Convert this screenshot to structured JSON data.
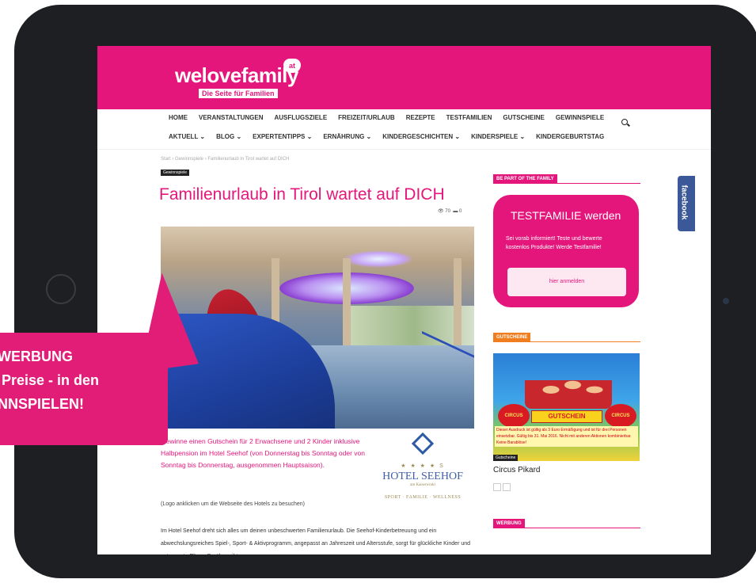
{
  "site": {
    "logo": "welovefamily",
    "logo_badge": "at",
    "tagline": "Die Seite für Familien"
  },
  "nav": {
    "row1": [
      "HOME",
      "VERANSTALTUNGEN",
      "AUSFLUGSZIELE",
      "FREIZEIT/URLAUB",
      "REZEPTE",
      "TESTFAMILIEN",
      "GUTSCHEINE",
      "GEWINNSPIELE"
    ],
    "row2": [
      "AKTUELL ⌄",
      "BLOG ⌄",
      "EXPERTENTIPPS ⌄",
      "ERNÄHRUNG ⌄",
      "KINDERGESCHICHTEN ⌄",
      "KINDERSPIELE ⌄",
      "KINDERGEBURTSTAG"
    ]
  },
  "article": {
    "breadcrumb": "Start › Gewinnspiele › Familienurlaub in Tirol wartet auf DICH",
    "category": "Gewinnspiele",
    "title": "Familienurlaub in Tirol wartet auf DICH",
    "views": "👁 70",
    "comments": "▬ 0",
    "intro": "Gewinne einen Gutschein für 2 Erwachsene und 2 Kinder inklusive Halbpension im Hotel Seehof (von Donnerstag bis Sonntag oder von Sonntag bis Donnerstag, ausgenommen Hauptsaison).",
    "logo_note": "(Logo anklicken um die Webseite des Hotels zu besuchen)",
    "body": "Im Hotel Seehof dreht sich alles um deinen unbeschwerten Familienurlaub. Die Seehof-Kinderbetreuung und ein abwechslungsreiches Spiel-, Sport- & Aktivprogramm, angepasst an Jahreszeit und Altersstufe, sorgt für glückliche Kinder und entspannte Eltern. Darüber gibt es"
  },
  "hotel": {
    "stars": "★ ★ ★ ★ S",
    "name": "HOTEL SEEHOF",
    "sub": "am Kaiserwinkl",
    "tagline": "SPORT · FAMILIE · WELLNESS"
  },
  "sidebar": {
    "family_header": "BE PART OF THE FAMILY",
    "tf_title": "TESTFAMILIE werden",
    "tf_text": "Sei vorab informiert! Teste und bewerte kostenlos Produkte! Werde Testfamilie!",
    "tf_button": "hier anmelden",
    "gutschein_header": "GUTSCHEINE",
    "promo_badge": "CIRCUS PIKARD",
    "promo_ribbon": "GUTSCHEIN",
    "promo_text": "Dieser Ausdruck ist gültig als 3 Euro Ermäßigung und ist für drei Personen einsetzbar. Gültig bis 31. Mai 2016. Nicht mit anderen Aktionen kombinierbar. Keine Barablöse!",
    "promo_label": "Gutscheine",
    "promo_title": "Circus Pikard",
    "werbung_header": "WERBUNG"
  },
  "facebook": "facebook",
  "callout": {
    "line1": "E WERBUNG",
    "line2": "re Preise - in den",
    "line3": "VINNSPIELEN!"
  },
  "colors": {
    "brand_pink": "#e5167b",
    "sidebar_orange": "#f07d1e",
    "facebook_blue": "#3b5998"
  }
}
